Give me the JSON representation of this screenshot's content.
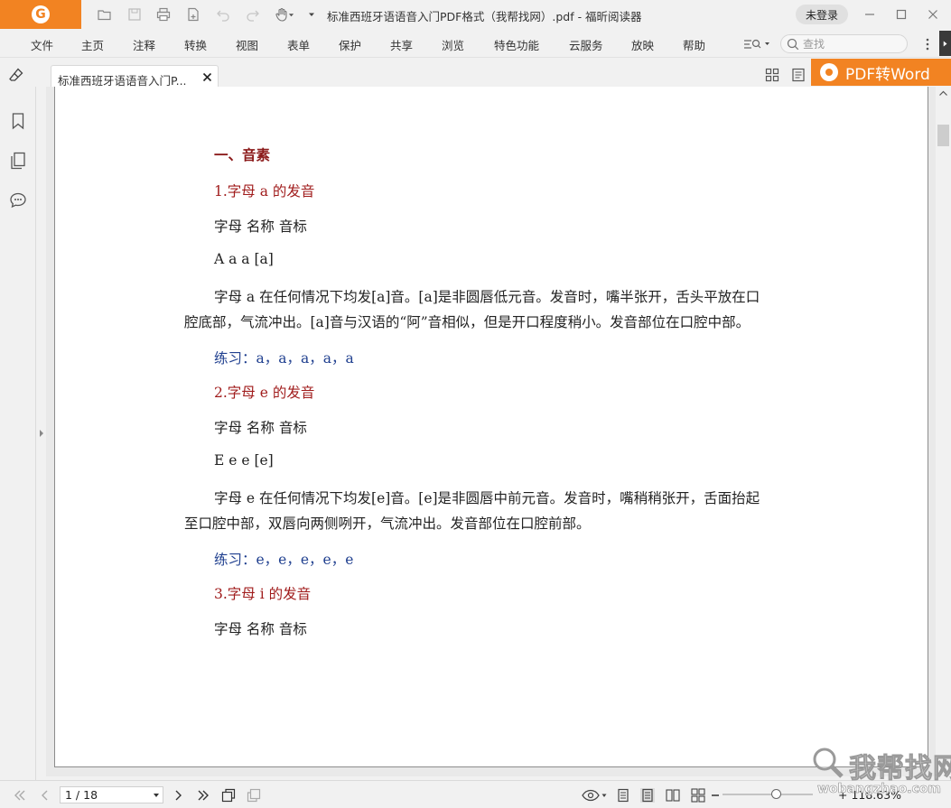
{
  "window": {
    "title": "标准西班牙语语音入门PDF格式（我帮找网）.pdf - 福昕阅读器",
    "login_label": "未登录"
  },
  "menu": {
    "items": [
      "文件",
      "主页",
      "注释",
      "转换",
      "视图",
      "表单",
      "保护",
      "共享",
      "浏览",
      "特色功能",
      "云服务",
      "放映",
      "帮助"
    ],
    "search_placeholder": "查找"
  },
  "tab": {
    "label": "标准西班牙语语音入门P..."
  },
  "promo": {
    "label": "PDF转Word"
  },
  "document": {
    "lines": [
      "一、音素",
      "1.字母 a 的发音",
      "字母  名称  音标",
      "A  a  a  [a]",
      "字母 a 在任何情况下均发[a]音。[a]是非圆唇低元音。发音时，嘴半张开，舌头平放在口",
      "腔底部，气流冲出。[a]音与汉语的“阿”音相似，但是开口程度稍小。发音部位在口腔中部。",
      "练习：a，a，a，a，a",
      "2.字母 e 的发音",
      "字母  名称  音标",
      "E  e  e  [e]",
      "字母 e 在任何情况下均发[e]音。[e]是非圆唇中前元音。发音时，嘴稍稍张开，舌面抬起",
      "至口腔中部，双唇向两侧咧开，气流冲出。发音部位在口腔前部。",
      "练习：e，e，e，e，e",
      "3.字母 i 的发音",
      "字母  名称  音标"
    ]
  },
  "status": {
    "page_indicator": "1 / 18",
    "zoom": "+ 118.63%"
  },
  "watermark": {
    "main": "我帮找网",
    "sub": "wobangzhao.com"
  },
  "colors": {
    "brand": "#f28322",
    "heading": "#8b1a1a",
    "subheading": "#a01c1c",
    "practice": "#1f3f8f"
  }
}
